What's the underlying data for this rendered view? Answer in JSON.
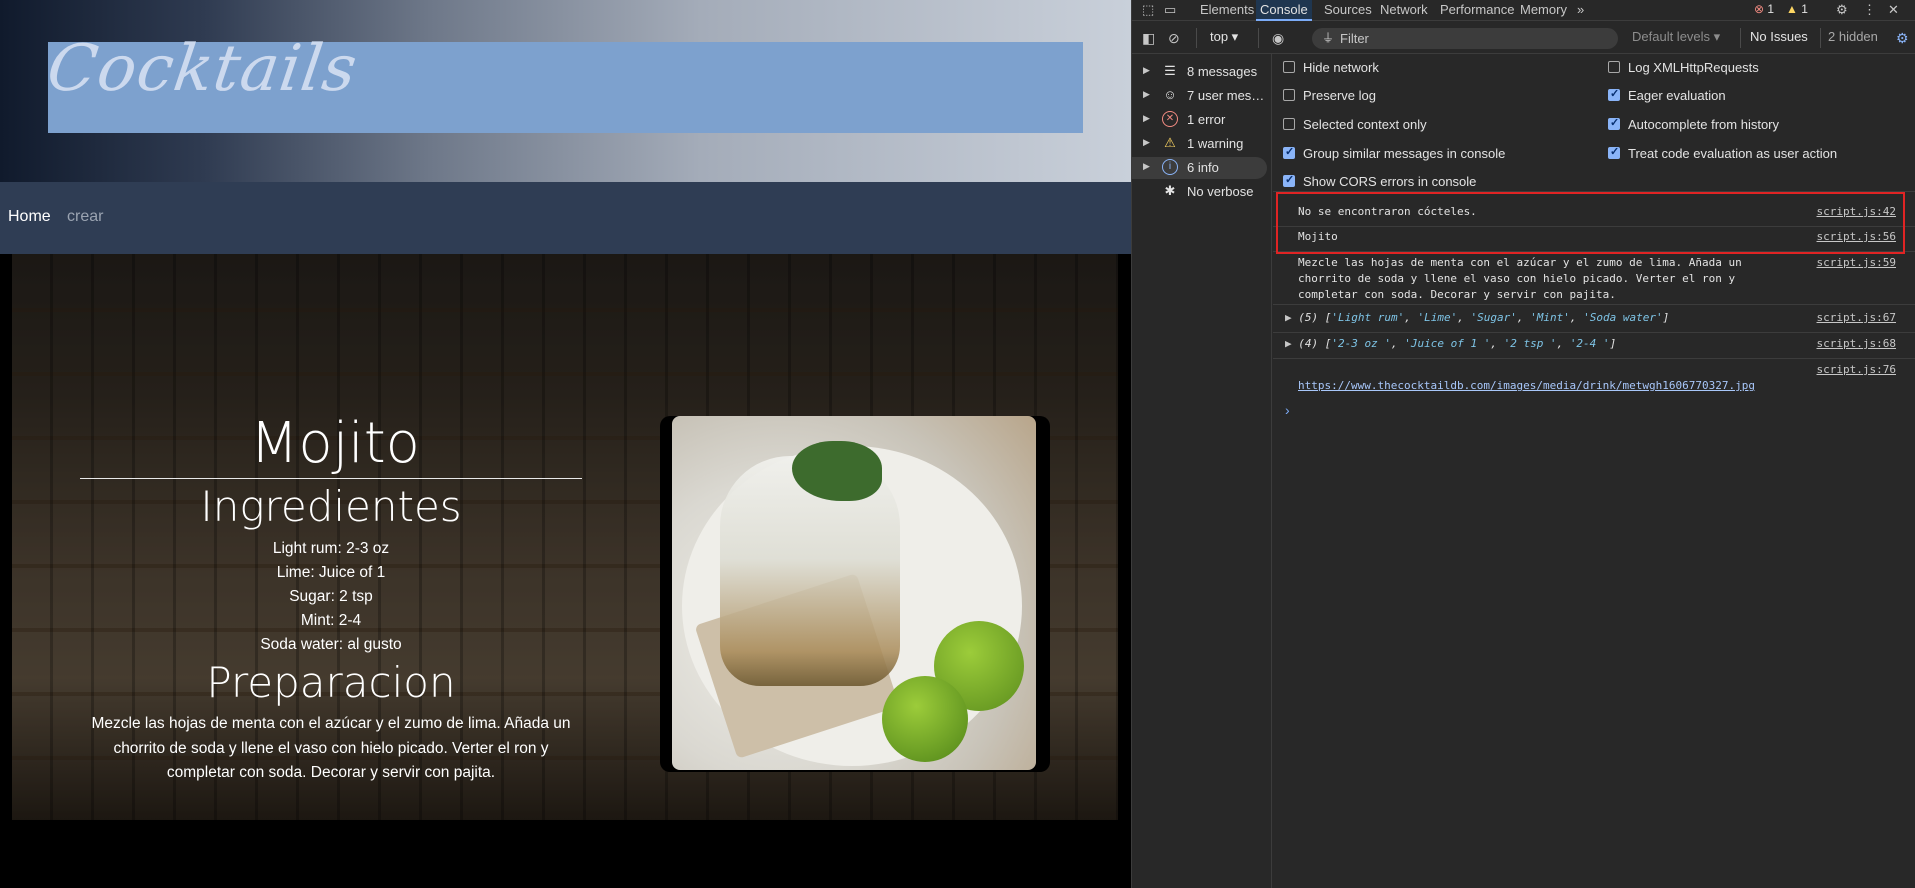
{
  "page": {
    "logo_text": "Cocktails",
    "nav": {
      "home": "Home",
      "crear": "crear"
    },
    "drink": {
      "name": "Mojito",
      "ingredients_heading": "Ingredientes",
      "ingredients": [
        "Light rum: 2-3 oz",
        "Lime: Juice of 1",
        "Sugar: 2 tsp",
        "Mint: 2-4",
        "Soda water: al gusto"
      ],
      "preparation_heading": "Preparacion",
      "preparation": "Mezcle las hojas de menta con el azúcar y el zumo de lima. Añada un chorrito de soda y llene el vaso con hielo picado. Verter el ron y completar con soda. Decorar y servir con pajita."
    }
  },
  "devtools": {
    "tabs": [
      "Elements",
      "Console",
      "Sources",
      "Network",
      "Performance",
      "Memory"
    ],
    "active_tab": "Console",
    "more_tabs": "»",
    "error_count": "1",
    "warning_count": "1",
    "toolbar": {
      "context": "top ▾",
      "filter_placeholder": "Filter",
      "levels": "Default levels ▾",
      "issues": "No Issues",
      "hidden": "2 hidden"
    },
    "sidebar": [
      {
        "label": "8 messages",
        "icon": "list-icon"
      },
      {
        "label": "7 user mes…",
        "icon": "user-icon"
      },
      {
        "label": "1 error",
        "icon": "error-icon"
      },
      {
        "label": "1 warning",
        "icon": "warning-icon"
      },
      {
        "label": "6 info",
        "icon": "info-icon"
      },
      {
        "label": "No verbose",
        "icon": "bug-icon"
      }
    ],
    "settings_left": [
      {
        "label": "Hide network",
        "checked": false
      },
      {
        "label": "Preserve log",
        "checked": false
      },
      {
        "label": "Selected context only",
        "checked": false
      },
      {
        "label": "Group similar messages in console",
        "checked": true
      },
      {
        "label": "Show CORS errors in console",
        "checked": true
      }
    ],
    "settings_right": [
      {
        "label": "Log XMLHttpRequests",
        "checked": false
      },
      {
        "label": "Eager evaluation",
        "checked": true
      },
      {
        "label": "Autocomplete from history",
        "checked": true
      },
      {
        "label": "Treat code evaluation as user action",
        "checked": true
      }
    ],
    "messages": [
      {
        "text": "No se encontraron cócteles.",
        "source": "script.js:42"
      },
      {
        "text": "Mojito",
        "source": "script.js:56"
      },
      {
        "text": "Mezcle las hojas de menta con el azúcar y el zumo de lima. Añada un chorrito de soda y llene el vaso con hielo picado. Verter el ron y completar con soda. Decorar y servir con pajita.",
        "source": "script.js:59"
      },
      {
        "count": "(5)",
        "items": [
          "'Light rum'",
          "'Lime'",
          "'Sugar'",
          "'Mint'",
          "'Soda water'"
        ],
        "source": "script.js:67"
      },
      {
        "count": "(4)",
        "items": [
          "'2-3 oz '",
          "'Juice of 1 '",
          "'2 tsp '",
          "'2-4 '"
        ],
        "source": "script.js:68"
      },
      {
        "link": "https://www.thecocktaildb.com/images/media/drink/metwgh1606770327.jpg",
        "source": "script.js:76"
      }
    ],
    "prompt": "›"
  }
}
